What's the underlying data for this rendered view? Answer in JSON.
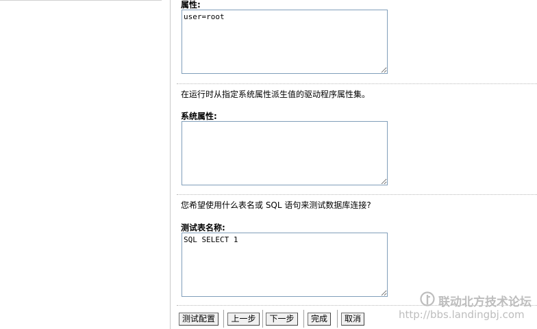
{
  "form": {
    "properties": {
      "label": "属性:",
      "value": "user=root"
    },
    "system_properties_hint": "在运行时从指定系统属性派生值的驱动程序属性集。",
    "system_properties": {
      "label": "系统属性:",
      "value": ""
    },
    "test_hint": "您希望使用什么表名或 SQL 语句来测试数据库连接?",
    "test_table": {
      "label": "测试表名称:",
      "value": "SQL SELECT 1"
    }
  },
  "buttons": {
    "test_config": "测试配置",
    "previous": "上一步",
    "next": "下一步",
    "finish": "完成",
    "cancel": "取消"
  },
  "watermark": {
    "name": "联动北方技术论坛",
    "url": "http://bbs.landingbj.com"
  }
}
